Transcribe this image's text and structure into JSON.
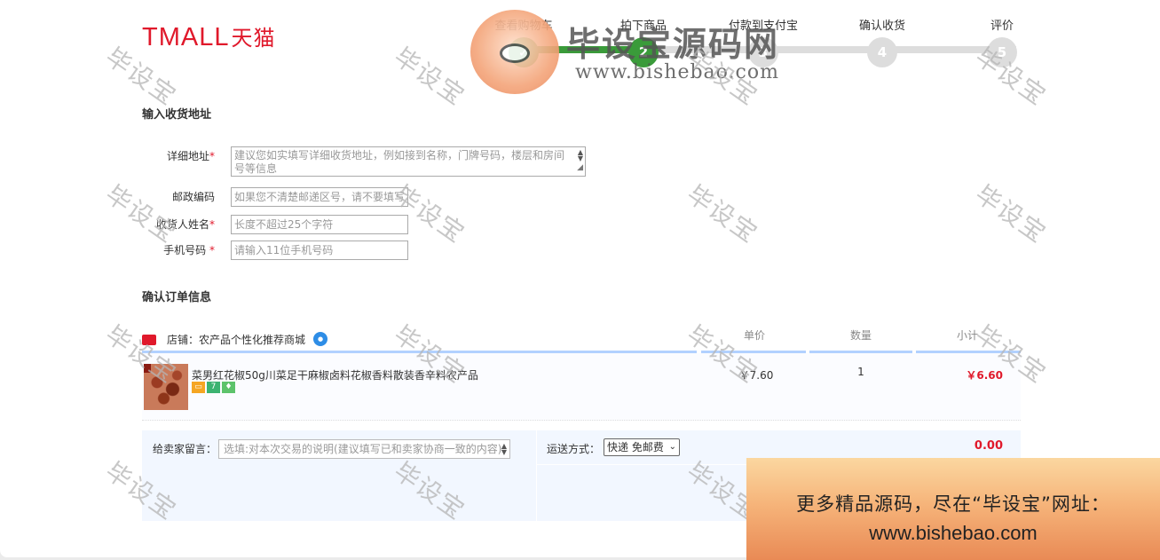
{
  "brand": {
    "logo_latin": "TMALL",
    "logo_cn": "天猫"
  },
  "steps": [
    {
      "label": "查看购物车",
      "num": "✓",
      "done": true
    },
    {
      "label": "拍下商品",
      "num": "2",
      "done": true
    },
    {
      "label": "付款到支付宝",
      "num": "3",
      "done": false
    },
    {
      "label": "确认收货",
      "num": "4",
      "done": false
    },
    {
      "label": "评价",
      "num": "5",
      "done": false
    }
  ],
  "watermark": {
    "title": "毕设宝源码网",
    "url": "www.bishebao.com",
    "tile": "毕设宝"
  },
  "address": {
    "section_title": "输入收货地址",
    "fields": [
      {
        "label": "详细地址",
        "required": "*",
        "placeholder": "建议您如实填写详细收货地址，例如接到名称，门牌号码，楼层和房间号等信息"
      },
      {
        "label": "邮政编码",
        "required": "",
        "placeholder": "如果您不清楚邮递区号，请不要填写"
      },
      {
        "label": "收货人姓名",
        "required": "*",
        "placeholder": "长度不超过25个字符"
      },
      {
        "label": "手机号码",
        "required": " *",
        "placeholder": "请输入11位手机号码"
      }
    ]
  },
  "order": {
    "section_title": "确认订单信息",
    "shop_label": "店铺：农产品个性化推荐商城",
    "columns": {
      "price": "单价",
      "qty": "数量",
      "subtotal": "小计"
    },
    "item": {
      "name": "菜男红花椒50g川菜足干麻椒卤料花椒香料散装香辛料农产品",
      "price": "￥7.60",
      "qty": "1",
      "subtotal": "￥6.60"
    },
    "message_label": "给卖家留言：",
    "message_placeholder": "选填:对本次交易的说明(建议填写已和卖家协商一致的内容)",
    "shipping_label": "运送方式：",
    "shipping_value": "快递 免邮费",
    "shipping_fee": "0.00"
  },
  "promo": {
    "line1": "更多精品源码，尽在“毕设宝”网址：",
    "line2": "www.bishebao.com"
  }
}
